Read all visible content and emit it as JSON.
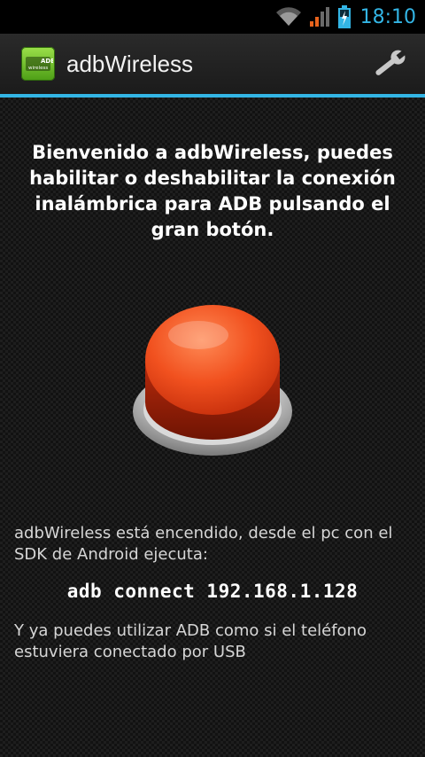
{
  "status_bar": {
    "time": "18:10",
    "icons": [
      "wifi-icon",
      "signal-icon",
      "battery-charging-icon"
    ],
    "accent": "#33b5e5"
  },
  "action_bar": {
    "title": "adbWireless",
    "app_icon": {
      "name": "adb-wireless-app-icon",
      "text_top": "ADB",
      "text_bottom": "wireless"
    },
    "settings_icon": "wrench-icon"
  },
  "main": {
    "welcome_text": "Bienvenido a adbWireless, puedes habilitar o deshabilitar la conexión inalámbrica para ADB pulsando el gran botón.",
    "toggle_button": {
      "icon": "big-red-button",
      "color": "#e8421c"
    },
    "status_text": "adbWireless está encendido, desde el pc con el SDK de Android ejecuta:",
    "command": "adb connect 192.168.1.128",
    "hint_text": "Y ya puedes utilizar ADB como si el teléfono estuviera conectado por USB"
  }
}
